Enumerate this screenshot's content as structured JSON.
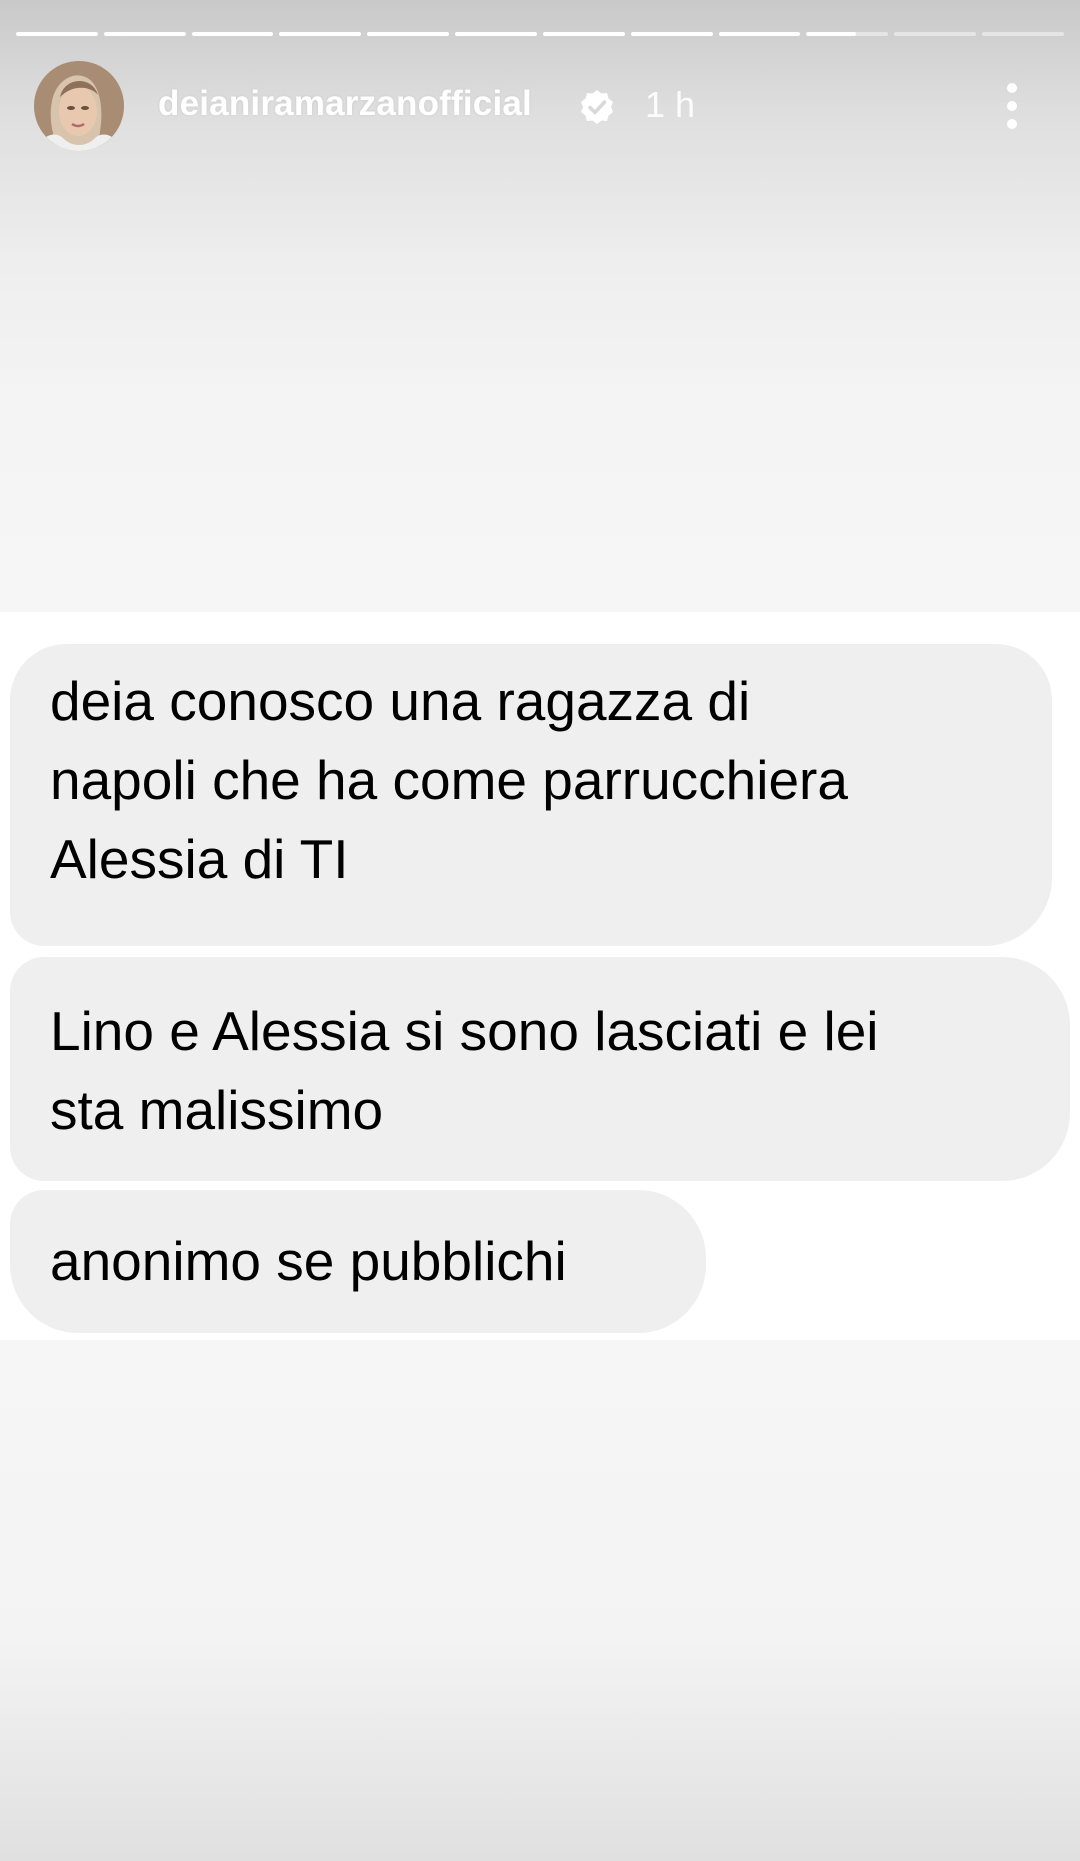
{
  "story": {
    "progress": {
      "segment_count": 12,
      "current_segment_index": 9,
      "current_segment_fraction": 0.6
    },
    "header": {
      "username": "deianiramarzanofficial",
      "verified": true,
      "time": "1 h",
      "verified_icon": "verified-badge-icon",
      "menu_icon": "more-vertical-icon"
    },
    "messages": [
      {
        "lines": [
          "deia conosco una ragazza di",
          "napoli che ha come parrucchiera",
          "Alessia di TI"
        ]
      },
      {
        "lines": [
          "Lino e Alessia si sono lasciati e lei",
          "sta malissimo"
        ]
      },
      {
        "lines": [
          "anonimo se pubblichi"
        ]
      }
    ]
  },
  "colors": {
    "bubble": "#efefef",
    "message_text": "#000000",
    "header_text": "#ffffff",
    "screenshot_background": "#ffffff"
  }
}
